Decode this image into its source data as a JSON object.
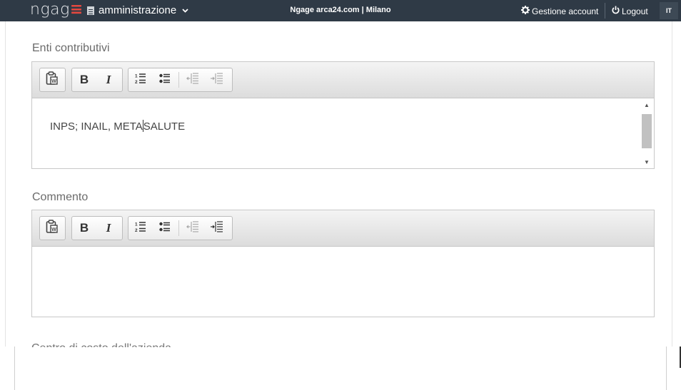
{
  "topbar": {
    "logo": {
      "text": "ngag",
      "accent": "≡"
    },
    "module": {
      "label": "amministrazione",
      "icon": "document-icon"
    },
    "center_title": "Ngage arca24.com | Milano",
    "account_label": "Gestione account",
    "logout_label": "Logout",
    "language": "IT"
  },
  "fields": [
    {
      "label": "Enti contributivi",
      "value_before_caret": "INPS; INAIL, META",
      "value_after_caret": "SALUTE"
    },
    {
      "label": "Commento",
      "value_before_caret": "",
      "value_after_caret": ""
    }
  ],
  "next_field_label": "Centro di costo dell'azienda",
  "toolbar": {
    "bold": "B",
    "italic": "I",
    "buttons": [
      "paste-from-word",
      "bold",
      "italic",
      "numbered-list",
      "bulleted-list",
      "decrease-indent",
      "increase-indent"
    ]
  },
  "colors": {
    "topbar_bg": "#2f3a46",
    "logo_accent": "#e4483f",
    "label_text": "#6b6b6b"
  }
}
